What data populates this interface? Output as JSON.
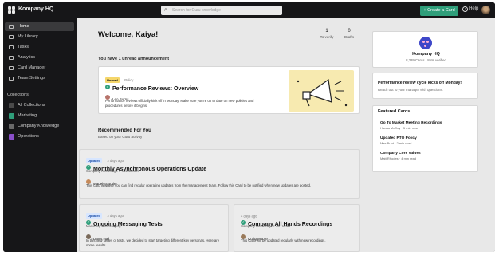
{
  "app": {
    "name": "Kompany HQ"
  },
  "search": {
    "placeholder": "Search for Guru knowledge"
  },
  "header": {
    "create_label": "+ Create a Card",
    "help_label": "Help"
  },
  "sidebar": {
    "nav": [
      {
        "label": "Home",
        "icon": "home-icon"
      },
      {
        "label": "My Library",
        "icon": "library-icon"
      },
      {
        "label": "Tasks",
        "icon": "tasks-icon"
      },
      {
        "label": "Analytics",
        "icon": "analytics-icon"
      },
      {
        "label": "Card Manager",
        "icon": "card-manager-icon"
      },
      {
        "label": "Team Settings",
        "icon": "settings-icon"
      }
    ],
    "collections_title": "Collections",
    "collections": [
      {
        "label": "All Collections",
        "color": "#4a4a4a"
      },
      {
        "label": "Marketing",
        "color": "#2f9e7a"
      },
      {
        "label": "Company Knowledge",
        "color": "#6a6a6a"
      },
      {
        "label": "Operations",
        "color": "#8a4fc9"
      }
    ]
  },
  "main": {
    "welcome": "Welcome, Kaiya!",
    "stats": [
      {
        "value": "1",
        "label": "To verify"
      },
      {
        "value": "0",
        "label": "Drafts"
      }
    ],
    "announcement_heading": "You have 1 unread announcement",
    "announcement": {
      "badge": "Unread",
      "meta": "Policy",
      "title": "Performance Reviews: Overview",
      "author": "Leo Burns",
      "body": "Performance reviews officially kick off in Monday. Make sure you're up to date on new policies and procedures before it begins."
    },
    "recommended_title": "Recommended For You",
    "recommended_sub": "Based on your Guru activity",
    "cards": [
      {
        "badge": "Updated",
        "meta": "2 days ago",
        "title": "Monthly Asynchronous Operations Update",
        "collection": "Company Knowledge > Newsletters",
        "author": "Madelyn Butler",
        "body": "This card is where you can find regular operating updates from the management team. Follow this Card to be notified when new updates are posted."
      },
      {
        "badge": "Updated",
        "meta": "2 days ago",
        "title": "Ongoing Messaging Tests",
        "collection": "Marketing > Messaging",
        "author": "Davis Hall",
        "body": "In this new series of tests, we decided to start targeting different key personas. Here are some results..."
      },
      {
        "badge": "",
        "meta": "4 days ago",
        "title": "Company All Hands Recordings",
        "collection": "Company Knowledge > All Hands",
        "author": "Craig Moore",
        "body": "This Card will be updated regularly with new recordings."
      }
    ]
  },
  "right": {
    "company_name": "Kompany HQ",
    "company_stats": "8,389 Cards · 85% verified",
    "promo_title": "Performance review cycle kicks off Monday!",
    "promo_body": "Reach out to your manager with questions.",
    "featured_title": "Featured Cards",
    "featured": [
      {
        "title": "Go To Market Meeting Recordings",
        "meta": "Hanna McCoy · 5 min read"
      },
      {
        "title": "Updated PTO Policy",
        "meta": "Max Bunt · 2 min read"
      },
      {
        "title": "Company Core Values",
        "meta": "Matt Rhodes · 4 min read"
      }
    ]
  }
}
